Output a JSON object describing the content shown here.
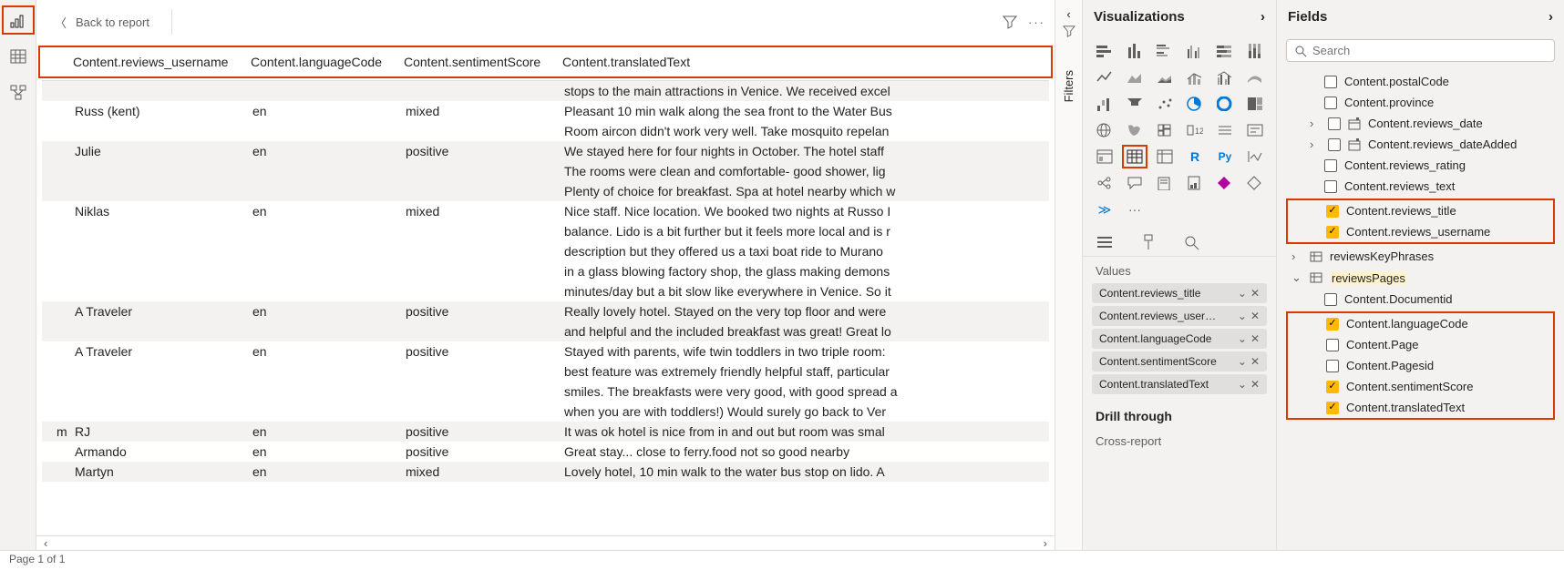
{
  "topbar": {
    "back_label": "Back to report"
  },
  "columns": {
    "c1": "Content.reviews_username",
    "c2": "Content.languageCode",
    "c3": "Content.sentimentScore",
    "c4": "Content.translatedText"
  },
  "rows": [
    {
      "m": "",
      "user": "",
      "lang": "",
      "sent": "",
      "text": "stops to the main attractions in Venice. We received excel",
      "alt": true
    },
    {
      "m": "",
      "user": "Russ (kent)",
      "lang": "en",
      "sent": "mixed",
      "text": "Pleasant 10 min walk along the sea front to the Water Bus",
      "alt": false
    },
    {
      "m": "",
      "user": "",
      "lang": "",
      "sent": "",
      "text": "Room aircon didn't work very well. Take mosquito repelan",
      "alt": false
    },
    {
      "m": "",
      "user": "Julie",
      "lang": "en",
      "sent": "positive",
      "text": "We stayed here for four nights in October. The hotel staff",
      "alt": true
    },
    {
      "m": "",
      "user": "",
      "lang": "",
      "sent": "",
      "text": "The rooms were clean and comfortable- good shower, lig",
      "alt": true
    },
    {
      "m": "",
      "user": "",
      "lang": "",
      "sent": "",
      "text": "Plenty of choice for breakfast. Spa at hotel nearby which w",
      "alt": true
    },
    {
      "m": "",
      "user": "Niklas",
      "lang": "en",
      "sent": "mixed",
      "text": "Nice staff. Nice location. We booked two nights at Russo I",
      "alt": false
    },
    {
      "m": "",
      "user": "",
      "lang": "",
      "sent": "",
      "text": "balance. Lido is a bit further but it feels more local and is r",
      "alt": false
    },
    {
      "m": "",
      "user": "",
      "lang": "",
      "sent": "",
      "text": "description but they offered us a taxi boat ride to Murano",
      "alt": false
    },
    {
      "m": "",
      "user": "",
      "lang": "",
      "sent": "",
      "text": "in a glass blowing factory shop, the glass making demons",
      "alt": false
    },
    {
      "m": "",
      "user": "",
      "lang": "",
      "sent": "",
      "text": "minutes/day but a bit slow like everywhere in Venice. So it",
      "alt": false
    },
    {
      "m": "",
      "user": "A Traveler",
      "lang": "en",
      "sent": "positive",
      "text": "Really lovely hotel. Stayed on the very top floor and were",
      "alt": true
    },
    {
      "m": "",
      "user": "",
      "lang": "",
      "sent": "",
      "text": "and helpful and the included breakfast was great! Great lo",
      "alt": true
    },
    {
      "m": "",
      "user": "A Traveler",
      "lang": "en",
      "sent": "positive",
      "text": "Stayed with parents, wife twin toddlers in two triple room:",
      "alt": false
    },
    {
      "m": "",
      "user": "",
      "lang": "",
      "sent": "",
      "text": "best feature was extremely friendly helpful staff, particular",
      "alt": false
    },
    {
      "m": "",
      "user": "",
      "lang": "",
      "sent": "",
      "text": "smiles. The breakfasts were very good, with good spread a",
      "alt": false
    },
    {
      "m": "",
      "user": "",
      "lang": "",
      "sent": "",
      "text": "when you are with toddlers!) Would surely go back to Ver",
      "alt": false
    },
    {
      "m": "m",
      "user": "RJ",
      "lang": "en",
      "sent": "positive",
      "text": "It was ok hotel is nice from in and out but room was smal",
      "alt": true
    },
    {
      "m": "",
      "user": "Armando",
      "lang": "en",
      "sent": "positive",
      "text": "Great stay... close to ferry.food not so good nearby",
      "alt": false
    },
    {
      "m": "",
      "user": "Martyn",
      "lang": "en",
      "sent": "mixed",
      "text": "Lovely hotel, 10 min walk to the water bus stop on lido. A",
      "alt": true
    }
  ],
  "status": "Page 1 of 1",
  "viz": {
    "title": "Visualizations",
    "values_label": "Values",
    "wells": [
      "Content.reviews_title",
      "Content.reviews_usernam",
      "Content.languageCode",
      "Content.sentimentScore",
      "Content.translatedText"
    ],
    "drill": "Drill through",
    "cross": "Cross-report"
  },
  "filters": {
    "label": "Filters"
  },
  "fields": {
    "title": "Fields",
    "search_placeholder": "Search",
    "items": [
      {
        "type": "leaf",
        "indent": 2,
        "checked": false,
        "label": "Content.postalCode"
      },
      {
        "type": "leaf",
        "indent": 2,
        "checked": false,
        "label": "Content.province"
      },
      {
        "type": "node",
        "indent": 1,
        "arrow": "›",
        "checked": false,
        "icon": "date",
        "label": "Content.reviews_date"
      },
      {
        "type": "node",
        "indent": 1,
        "arrow": "›",
        "checked": false,
        "icon": "date",
        "label": "Content.reviews_dateAdded"
      },
      {
        "type": "leaf",
        "indent": 2,
        "checked": false,
        "label": "Content.reviews_rating"
      },
      {
        "type": "leaf",
        "indent": 2,
        "checked": false,
        "label": "Content.reviews_text"
      }
    ],
    "red1": [
      {
        "type": "leaf",
        "indent": 2,
        "checked": true,
        "label": "Content.reviews_title"
      },
      {
        "type": "leaf",
        "indent": 2,
        "checked": true,
        "label": "Content.reviews_username"
      }
    ],
    "mid": [
      {
        "type": "table",
        "indent": 0,
        "arrow": "›",
        "label": "reviewsKeyPhrases"
      },
      {
        "type": "table",
        "indent": 0,
        "arrow": "⌄",
        "label": "reviewsPages",
        "highlighted": true
      },
      {
        "type": "leaf",
        "indent": 2,
        "checked": false,
        "label": "Content.Documentid"
      }
    ],
    "red2": [
      {
        "type": "leaf",
        "indent": 2,
        "checked": true,
        "label": "Content.languageCode"
      },
      {
        "type": "leaf",
        "indent": 2,
        "checked": false,
        "label": "Content.Page"
      },
      {
        "type": "leaf",
        "indent": 2,
        "checked": false,
        "label": "Content.Pagesid"
      },
      {
        "type": "leaf",
        "indent": 2,
        "checked": true,
        "label": "Content.sentimentScore"
      },
      {
        "type": "leaf",
        "indent": 2,
        "checked": true,
        "label": "Content.translatedText"
      }
    ]
  }
}
